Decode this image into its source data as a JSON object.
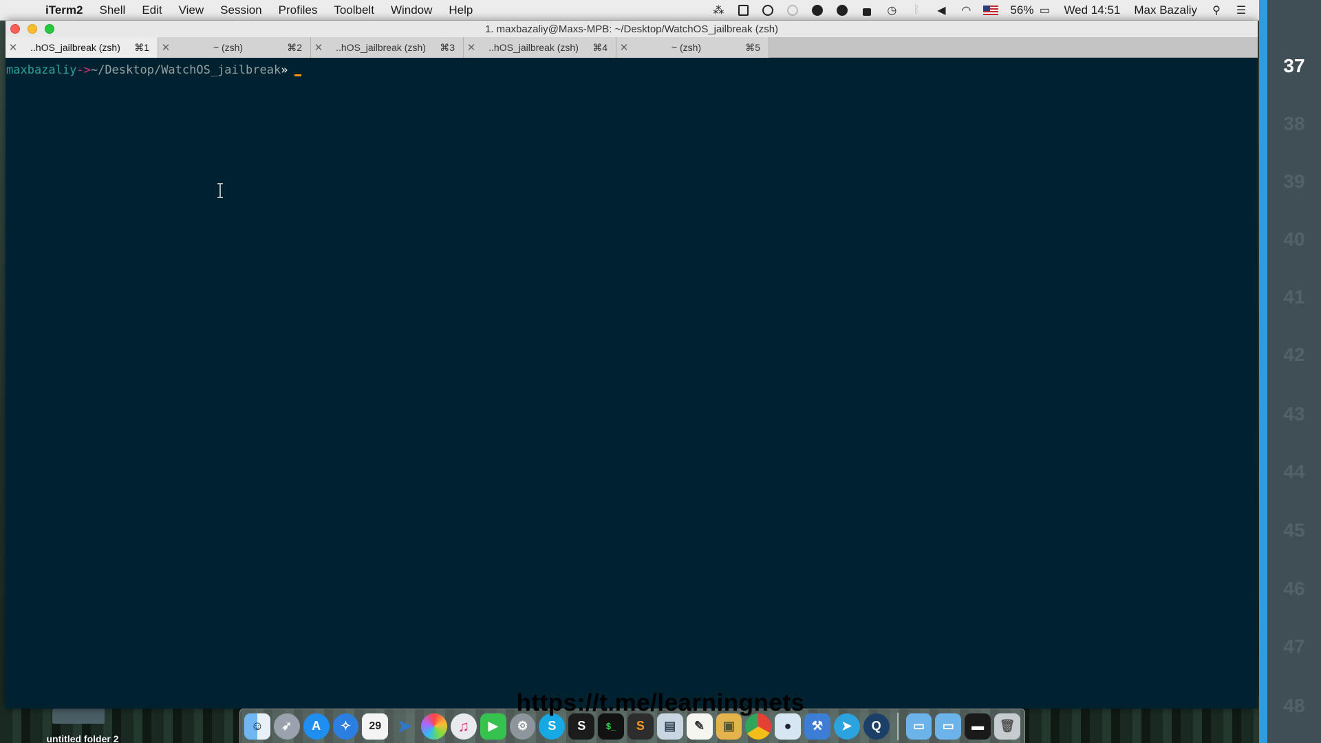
{
  "menubar": {
    "app_name": "iTerm2",
    "items": [
      "Shell",
      "Edit",
      "View",
      "Session",
      "Profiles",
      "Toolbelt",
      "Window",
      "Help"
    ],
    "battery": "56%",
    "clock": "Wed 14:51",
    "user": "Max Bazaliy"
  },
  "window": {
    "title": "1. maxbazaliy@Maxs-MPB: ~/Desktop/WatchOS_jailbreak (zsh)",
    "tabs": [
      {
        "title": "..hOS_jailbreak (zsh)",
        "key": "⌘1"
      },
      {
        "title": "~ (zsh)",
        "key": "⌘2"
      },
      {
        "title": "..hOS_jailbreak (zsh)",
        "key": "⌘3"
      },
      {
        "title": "..hOS_jailbreak (zsh)",
        "key": "⌘4"
      },
      {
        "title": "~ (zsh)",
        "key": "⌘5"
      }
    ]
  },
  "terminal": {
    "user": "maxbazaliy",
    "arrow": "->",
    "path": "~/Desktop/WatchOS_jailbreak",
    "symbol": "»"
  },
  "side_numbers": [
    "37",
    "38",
    "39",
    "40",
    "41",
    "42",
    "43",
    "44",
    "45",
    "46",
    "47",
    "48"
  ],
  "watermark": "https://t.me/learningnets",
  "desktop": {
    "folder_label": "untitled folder 2"
  },
  "colors": {
    "terminal_bg": "#002230",
    "prompt_user": "#2aa198",
    "prompt_arrow": "#d33682",
    "cursor": "#ff9500",
    "accent_bar": "#2f9be0"
  }
}
